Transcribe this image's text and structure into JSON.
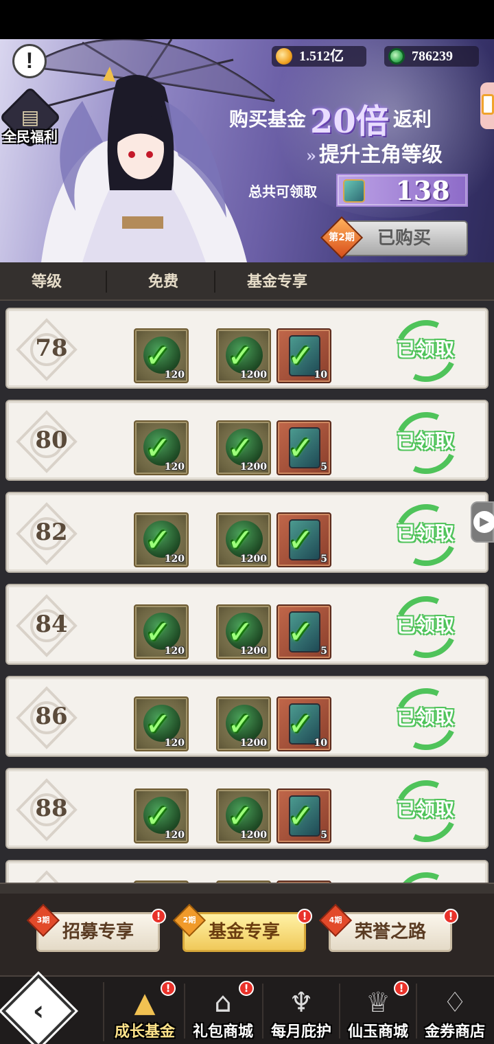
{
  "banner": {
    "warn_symbol": "!",
    "welfare_label": "全民福利",
    "currency": [
      {
        "icon": "gold-coin-icon",
        "value": "1.512亿"
      },
      {
        "icon": "jade-icon",
        "value": "786239"
      }
    ],
    "buy_prefix": "购买基金",
    "multiplier": "20倍",
    "buy_suffix": "返利",
    "levelup_text": "提升主角等级",
    "total_label": "总共可领取",
    "total_value": "138",
    "period_tag": "第2期",
    "bought_button": "已购买"
  },
  "table_header": {
    "level": "等级",
    "free": "免费",
    "fund": "基金专享"
  },
  "rows": [
    {
      "level": "78",
      "free_count": "120",
      "fund_count1": "1200",
      "fund_count2": "10",
      "status": "已领取"
    },
    {
      "level": "80",
      "free_count": "120",
      "fund_count1": "1200",
      "fund_count2": "5",
      "status": "已领取"
    },
    {
      "level": "82",
      "free_count": "120",
      "fund_count1": "1200",
      "fund_count2": "5",
      "status": "已领取"
    },
    {
      "level": "84",
      "free_count": "120",
      "fund_count1": "1200",
      "fund_count2": "5",
      "status": "已领取"
    },
    {
      "level": "86",
      "free_count": "120",
      "fund_count1": "1200",
      "fund_count2": "10",
      "status": "已领取"
    },
    {
      "level": "88",
      "free_count": "120",
      "fund_count1": "1200",
      "fund_count2": "5",
      "status": "已领取"
    }
  ],
  "tabs": [
    {
      "label": "招募专享",
      "ribbon": "3期"
    },
    {
      "label": "基金专享",
      "ribbon": "2期"
    },
    {
      "label": "荣誉之路",
      "ribbon": "4期"
    }
  ],
  "nav": {
    "back_symbol": "‹",
    "items": [
      {
        "label": "成长基金",
        "icon": "growth-fund-icon"
      },
      {
        "label": "礼包商城",
        "icon": "gift-shop-icon"
      },
      {
        "label": "每月庇护",
        "icon": "monthly-protection-icon"
      },
      {
        "label": "仙玉商城",
        "icon": "jade-shop-icon"
      },
      {
        "label": "金券商店",
        "icon": "diamond-shop-icon"
      }
    ]
  },
  "check_symbol": "✓",
  "badge_symbol": "!",
  "play_symbol": "▶"
}
